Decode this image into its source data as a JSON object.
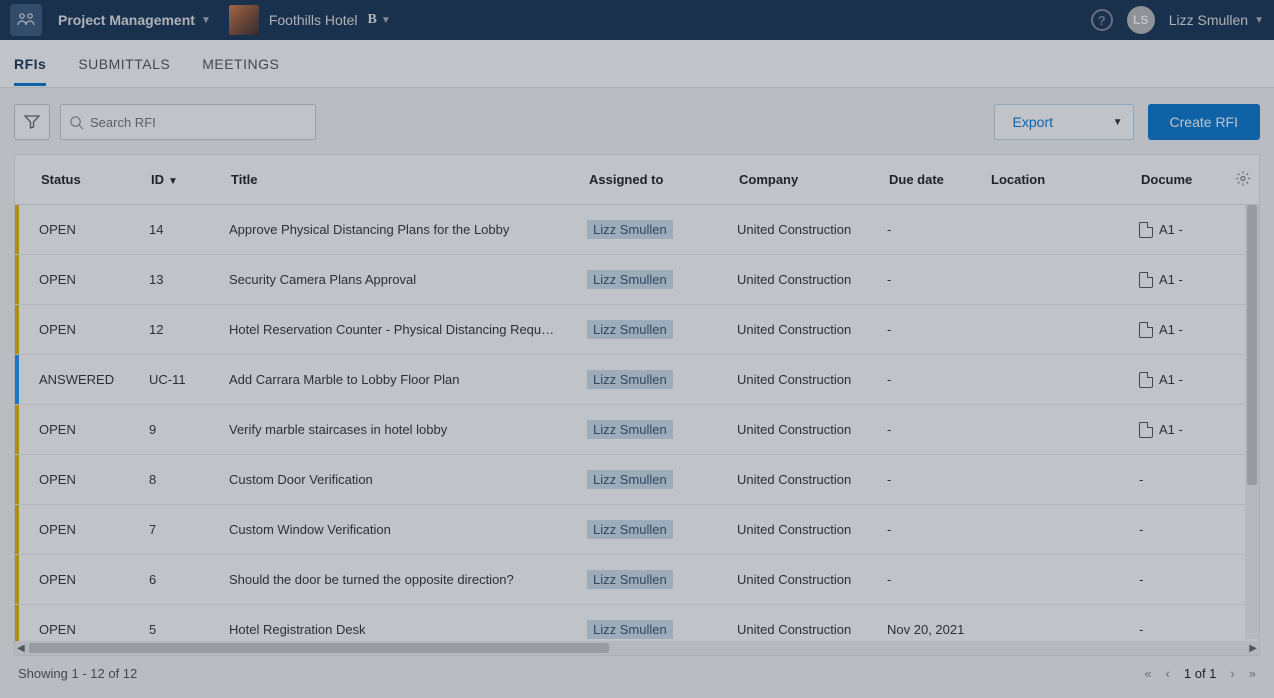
{
  "header": {
    "project_dropdown": "Project Management",
    "project_name": "Foothills Hotel",
    "b_label": "B",
    "user_initials": "LS",
    "user_name": "Lizz Smullen"
  },
  "tabs": {
    "rfis": "RFIs",
    "submittals": "SUBMITTALS",
    "meetings": "MEETINGS"
  },
  "toolbar": {
    "search_placeholder": "Search RFI",
    "export_label": "Export",
    "create_label": "Create RFI"
  },
  "columns": {
    "status": "Status",
    "id": "ID",
    "title": "Title",
    "assigned": "Assigned to",
    "company": "Company",
    "due": "Due date",
    "location": "Location",
    "document": "Docume"
  },
  "rows": [
    {
      "status": "OPEN",
      "status_class": "open",
      "id": "14",
      "title": "Approve Physical Distancing Plans for the Lobby",
      "assigned": "Lizz Smullen",
      "company": "United Construction",
      "due": "-",
      "location": "",
      "doc": "A1 -",
      "has_doc": true
    },
    {
      "status": "OPEN",
      "status_class": "open",
      "id": "13",
      "title": "Security Camera Plans Approval",
      "assigned": "Lizz Smullen",
      "company": "United Construction",
      "due": "-",
      "location": "",
      "doc": "A1 -",
      "has_doc": true
    },
    {
      "status": "OPEN",
      "status_class": "open",
      "id": "12",
      "title": "Hotel Reservation Counter - Physical Distancing Requ…",
      "assigned": "Lizz Smullen",
      "company": "United Construction",
      "due": "-",
      "location": "",
      "doc": "A1 -",
      "has_doc": true
    },
    {
      "status": "ANSWERED",
      "status_class": "answered",
      "id": "UC-11",
      "title": "Add Carrara Marble to Lobby Floor Plan",
      "assigned": "Lizz Smullen",
      "company": "United Construction",
      "due": "-",
      "location": "",
      "doc": "A1 -",
      "has_doc": true
    },
    {
      "status": "OPEN",
      "status_class": "open",
      "id": "9",
      "title": "Verify marble staircases in hotel lobby",
      "assigned": "Lizz Smullen",
      "company": "United Construction",
      "due": "-",
      "location": "",
      "doc": "A1 -",
      "has_doc": true
    },
    {
      "status": "OPEN",
      "status_class": "open",
      "id": "8",
      "title": "Custom Door Verification",
      "assigned": "Lizz Smullen",
      "company": "United Construction",
      "due": "-",
      "location": "",
      "doc": "-",
      "has_doc": false
    },
    {
      "status": "OPEN",
      "status_class": "open",
      "id": "7",
      "title": "Custom Window Verification",
      "assigned": "Lizz Smullen",
      "company": "United Construction",
      "due": "-",
      "location": "",
      "doc": "-",
      "has_doc": false
    },
    {
      "status": "OPEN",
      "status_class": "open",
      "id": "6",
      "title": "Should the door be turned the opposite direction?",
      "assigned": "Lizz Smullen",
      "company": "United Construction",
      "due": "-",
      "location": "",
      "doc": "-",
      "has_doc": false
    },
    {
      "status": "OPEN",
      "status_class": "open",
      "id": "5",
      "title": "Hotel Registration Desk",
      "assigned": "Lizz Smullen",
      "company": "United Construction",
      "due": "Nov 20, 2021",
      "location": "",
      "doc": "-",
      "has_doc": false
    }
  ],
  "footer": {
    "showing": "Showing 1 - 12 of 12",
    "page": "1 of 1"
  }
}
